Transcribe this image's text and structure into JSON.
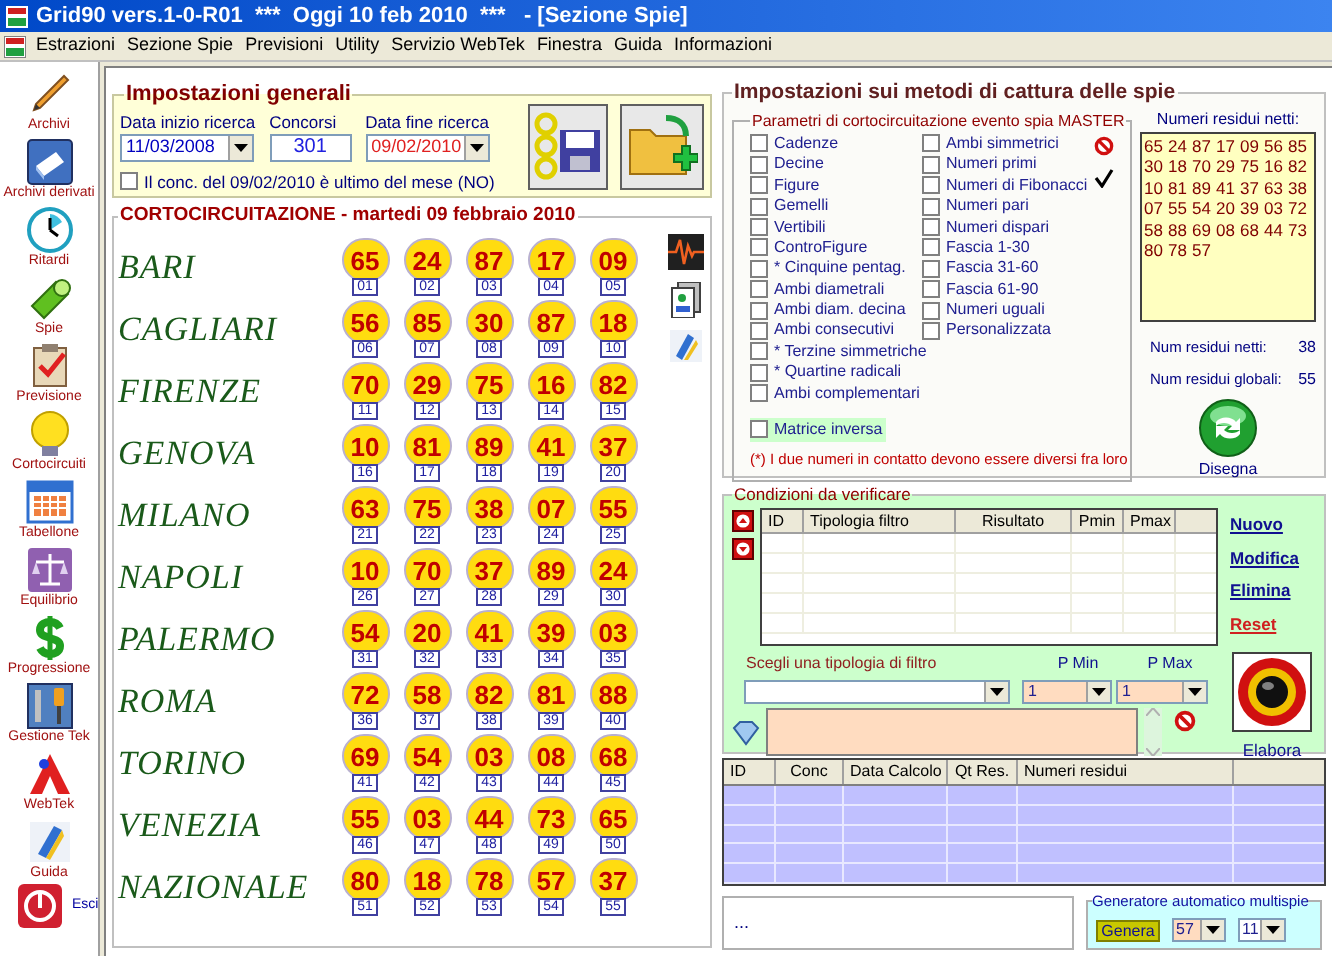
{
  "window": {
    "title": "Grid90 vers.1-0-R01  ***  Oggi 10 feb 2010  ***   - [Sezione Spie]"
  },
  "menu": [
    "Estrazioni",
    "Sezione Spie",
    "Previsioni",
    "Utility",
    "Servizio WebTek",
    "Finestra",
    "Guida",
    "Informazioni"
  ],
  "sidebar": {
    "items": [
      {
        "label": "Archivi",
        "kind": "pencil"
      },
      {
        "label": "Archivi derivati",
        "kind": "book"
      },
      {
        "label": "Ritardi",
        "kind": "clock"
      },
      {
        "label": "Spie",
        "kind": "flashlight"
      },
      {
        "label": "Previsione",
        "kind": "clipboard"
      },
      {
        "label": "Cortocircuiti",
        "kind": "bulb"
      },
      {
        "label": "Tabellone",
        "kind": "calendar"
      },
      {
        "label": "Equilibrio",
        "kind": "scales"
      },
      {
        "label": "Progressione",
        "kind": "dollar"
      },
      {
        "label": "Gestione Tek",
        "kind": "tools"
      },
      {
        "label": "WebTek",
        "kind": "webtek"
      },
      {
        "label": "Guida",
        "kind": "guide"
      },
      {
        "label": "Esci",
        "kind": "exit"
      }
    ]
  },
  "general_settings": {
    "title": "Impostazioni generali",
    "start_date": {
      "label": "Data inizio ricerca",
      "value": "11/03/2008"
    },
    "draws": {
      "label": "Concorsi",
      "value": "301"
    },
    "end_date": {
      "label": "Data fine ricerca",
      "value": "09/02/2010"
    },
    "last_of_month": {
      "label": "Il conc. del 09/02/2010 è ultimo del mese (NO)",
      "checked": false
    }
  },
  "short_circuit": {
    "title": "CORTOCIRCUITAZIONE - martedi 09 febbraio 2010",
    "wheels": [
      {
        "name": "BARI",
        "numbers": [
          {
            "value": "65",
            "index": "01"
          },
          {
            "value": "24",
            "index": "02"
          },
          {
            "value": "87",
            "index": "03"
          },
          {
            "value": "17",
            "index": "04"
          },
          {
            "value": "09",
            "index": "05"
          }
        ]
      },
      {
        "name": "CAGLIARI",
        "numbers": [
          {
            "value": "56",
            "index": "06"
          },
          {
            "value": "85",
            "index": "07"
          },
          {
            "value": "30",
            "index": "08"
          },
          {
            "value": "87",
            "index": "09"
          },
          {
            "value": "18",
            "index": "10"
          }
        ]
      },
      {
        "name": "FIRENZE",
        "numbers": [
          {
            "value": "70",
            "index": "11"
          },
          {
            "value": "29",
            "index": "12"
          },
          {
            "value": "75",
            "index": "13"
          },
          {
            "value": "16",
            "index": "14"
          },
          {
            "value": "82",
            "index": "15"
          }
        ]
      },
      {
        "name": "GENOVA",
        "numbers": [
          {
            "value": "10",
            "index": "16"
          },
          {
            "value": "81",
            "index": "17"
          },
          {
            "value": "89",
            "index": "18"
          },
          {
            "value": "41",
            "index": "19"
          },
          {
            "value": "37",
            "index": "20"
          }
        ]
      },
      {
        "name": "MILANO",
        "numbers": [
          {
            "value": "63",
            "index": "21"
          },
          {
            "value": "75",
            "index": "22"
          },
          {
            "value": "38",
            "index": "23"
          },
          {
            "value": "07",
            "index": "24"
          },
          {
            "value": "55",
            "index": "25"
          }
        ]
      },
      {
        "name": "NAPOLI",
        "numbers": [
          {
            "value": "10",
            "index": "26"
          },
          {
            "value": "70",
            "index": "27"
          },
          {
            "value": "37",
            "index": "28"
          },
          {
            "value": "89",
            "index": "29"
          },
          {
            "value": "24",
            "index": "30"
          }
        ]
      },
      {
        "name": "PALERMO",
        "numbers": [
          {
            "value": "54",
            "index": "31"
          },
          {
            "value": "20",
            "index": "32"
          },
          {
            "value": "41",
            "index": "33"
          },
          {
            "value": "39",
            "index": "34"
          },
          {
            "value": "03",
            "index": "35"
          }
        ]
      },
      {
        "name": "ROMA",
        "numbers": [
          {
            "value": "72",
            "index": "36"
          },
          {
            "value": "58",
            "index": "37"
          },
          {
            "value": "82",
            "index": "38"
          },
          {
            "value": "81",
            "index": "39"
          },
          {
            "value": "88",
            "index": "40"
          }
        ]
      },
      {
        "name": "TORINO",
        "numbers": [
          {
            "value": "69",
            "index": "41"
          },
          {
            "value": "54",
            "index": "42"
          },
          {
            "value": "03",
            "index": "43"
          },
          {
            "value": "08",
            "index": "44"
          },
          {
            "value": "68",
            "index": "45"
          }
        ]
      },
      {
        "name": "VENEZIA",
        "numbers": [
          {
            "value": "55",
            "index": "46"
          },
          {
            "value": "03",
            "index": "47"
          },
          {
            "value": "44",
            "index": "48"
          },
          {
            "value": "73",
            "index": "49"
          },
          {
            "value": "65",
            "index": "50"
          }
        ]
      },
      {
        "name": "NAZIONALE",
        "numbers": [
          {
            "value": "80",
            "index": "51"
          },
          {
            "value": "18",
            "index": "52"
          },
          {
            "value": "78",
            "index": "53"
          },
          {
            "value": "57",
            "index": "54"
          },
          {
            "value": "37",
            "index": "55"
          }
        ]
      }
    ]
  },
  "capture_settings": {
    "title": "Impostazioni sui metodi di cattura delle spie",
    "parameters": {
      "title": "Parametri di cortocircuitazione evento spia MASTER",
      "left_options": [
        {
          "label": "Cadenze",
          "checked": false
        },
        {
          "label": "Decine",
          "checked": false
        },
        {
          "label": "Figure",
          "checked": false
        },
        {
          "label": "Gemelli",
          "checked": false
        },
        {
          "label": "Vertibili",
          "checked": false
        },
        {
          "label": "ControFigure",
          "checked": false
        },
        {
          "label": "* Cinquine pentag.",
          "checked": false
        },
        {
          "label": "Ambi diametrali",
          "checked": false
        },
        {
          "label": "Ambi diam. decina",
          "checked": false
        },
        {
          "label": "Ambi consecutivi",
          "checked": false
        },
        {
          "label": "* Terzine simmetriche",
          "checked": false
        },
        {
          "label": "* Quartine radicali",
          "checked": false
        },
        {
          "label": "Ambi complementari",
          "checked": false
        }
      ],
      "right_options": [
        {
          "label": "Ambi simmetrici",
          "checked": false
        },
        {
          "label": "Numeri primi",
          "checked": false
        },
        {
          "label": "Numeri di Fibonacci",
          "checked": false
        },
        {
          "label": "Numeri pari",
          "checked": false
        },
        {
          "label": "Numeri dispari",
          "checked": false
        },
        {
          "label": "Fascia 1-30",
          "checked": false
        },
        {
          "label": "Fascia 31-60",
          "checked": false
        },
        {
          "label": "Fascia 61-90",
          "checked": false
        },
        {
          "label": "Numeri uguali",
          "checked": false
        },
        {
          "label": "Personalizzata",
          "checked": false
        }
      ],
      "inverse_matrix": {
        "label": "Matrice inversa",
        "checked": false
      },
      "note": "(*) I due numeri in contatto devono essere diversi fra loro"
    },
    "residual": {
      "label": "Numeri residui netti:",
      "numbers": [
        "65",
        "24",
        "87",
        "17",
        "09",
        "56",
        "85",
        "30",
        "18",
        "70",
        "29",
        "75",
        "16",
        "82",
        "10",
        "81",
        "89",
        "41",
        "37",
        "63",
        "38",
        "07",
        "55",
        "54",
        "20",
        "39",
        "03",
        "72",
        "58",
        "88",
        "69",
        "08",
        "68",
        "44",
        "73",
        "80",
        "78",
        "57"
      ]
    },
    "counts": [
      {
        "label": "Num residui netti:",
        "value": "38"
      },
      {
        "label": "Num residui globali:",
        "value": "55"
      }
    ],
    "draw_button": "Disegna"
  },
  "conditions": {
    "title": "Condizioni da verificare",
    "columns": [
      "ID",
      "Tipologia filtro",
      "Risultato",
      "Pmin",
      "Pmax"
    ],
    "actions": [
      {
        "label": "Nuovo",
        "kind": "link"
      },
      {
        "label": "Modifica",
        "kind": "link"
      },
      {
        "label": "Elimina",
        "kind": "link"
      },
      {
        "label": "Reset",
        "kind": "danger"
      }
    ],
    "filter_label": "Scegli una tipologia di filtro",
    "p_min": {
      "label": "P Min",
      "value": "1"
    },
    "p_max": {
      "label": "P Max",
      "value": "1"
    },
    "run_button": "Elabora"
  },
  "results": {
    "columns": [
      "ID",
      "Conc",
      "Data Calcolo",
      "Qt Res.",
      "Numeri residui"
    ]
  },
  "message": "...",
  "generator": {
    "title": "Generatore automatico multispie",
    "button": "Genera",
    "first": "57",
    "second": "11"
  }
}
